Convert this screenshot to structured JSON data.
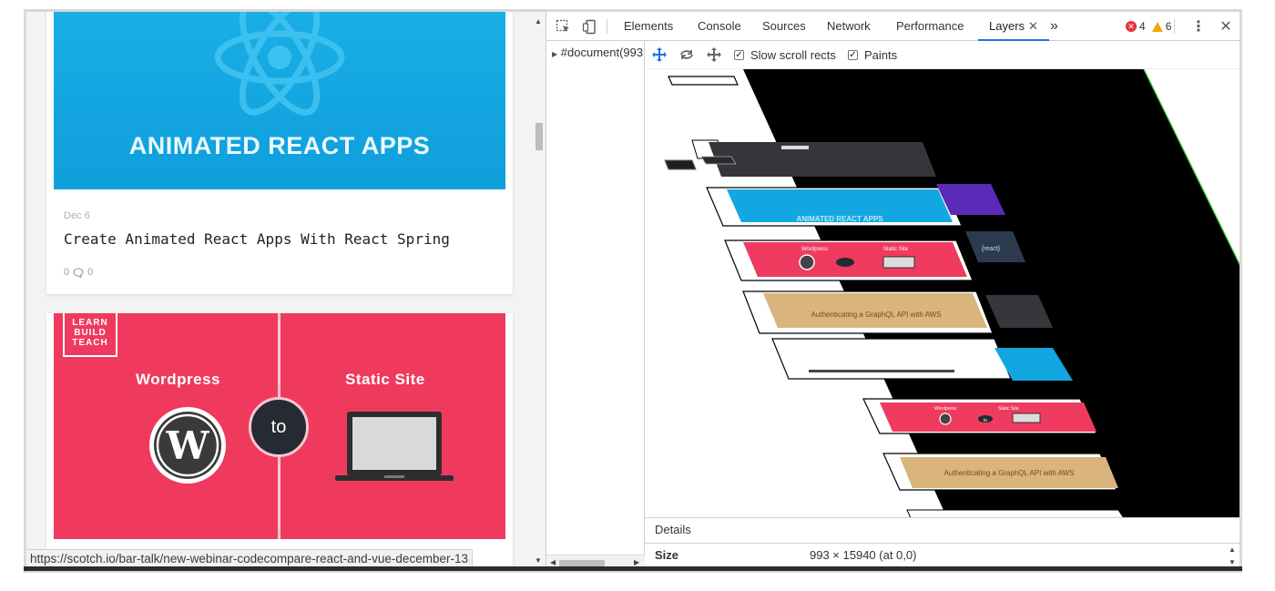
{
  "webpage": {
    "react_card": {
      "banner_title": "ANIMATED REACT APPS",
      "date": "Dec 6",
      "title": "Create Animated React Apps With React Spring",
      "likes": "0",
      "comments": "0"
    },
    "wp_card": {
      "logo_lines": [
        "LEARN",
        "BUILD",
        "TEACH"
      ],
      "left_label": "Wordpress",
      "right_label": "Static Site",
      "connector": "to"
    },
    "status_url": "https://scotch.io/bar-talk/new-webinar-codecompare-react-and-vue-december-13"
  },
  "devtools": {
    "tabs": [
      {
        "label": "Elements"
      },
      {
        "label": "Console"
      },
      {
        "label": "Sources"
      },
      {
        "label": "Network"
      },
      {
        "label": "Performance"
      },
      {
        "label": "Layers"
      }
    ],
    "active_tab": "Layers",
    "more_tabs_glyph": "»",
    "errors": "4",
    "warnings": "6",
    "tree_root": "#document(993",
    "layers_toolbar": {
      "slow_scroll_rects": "Slow scroll rects",
      "paints": "Paints"
    },
    "layer_thumbnails": {
      "react_title": "ANIMATED REACT APPS",
      "wp_left": "Wordpress",
      "wp_right": "Static Site",
      "wp_to": "to",
      "graphql": "Authenticating a GraphQL API with AWS",
      "react_badge": "{react}"
    },
    "details": {
      "tab": "Details",
      "size_key": "Size",
      "size_value": "993 × 15940 (at 0,0)"
    }
  },
  "colors": {
    "react_blue": "#0f9fdc",
    "wp_pink": "#ef3a5e",
    "devtools_accent": "#1a73e8"
  }
}
